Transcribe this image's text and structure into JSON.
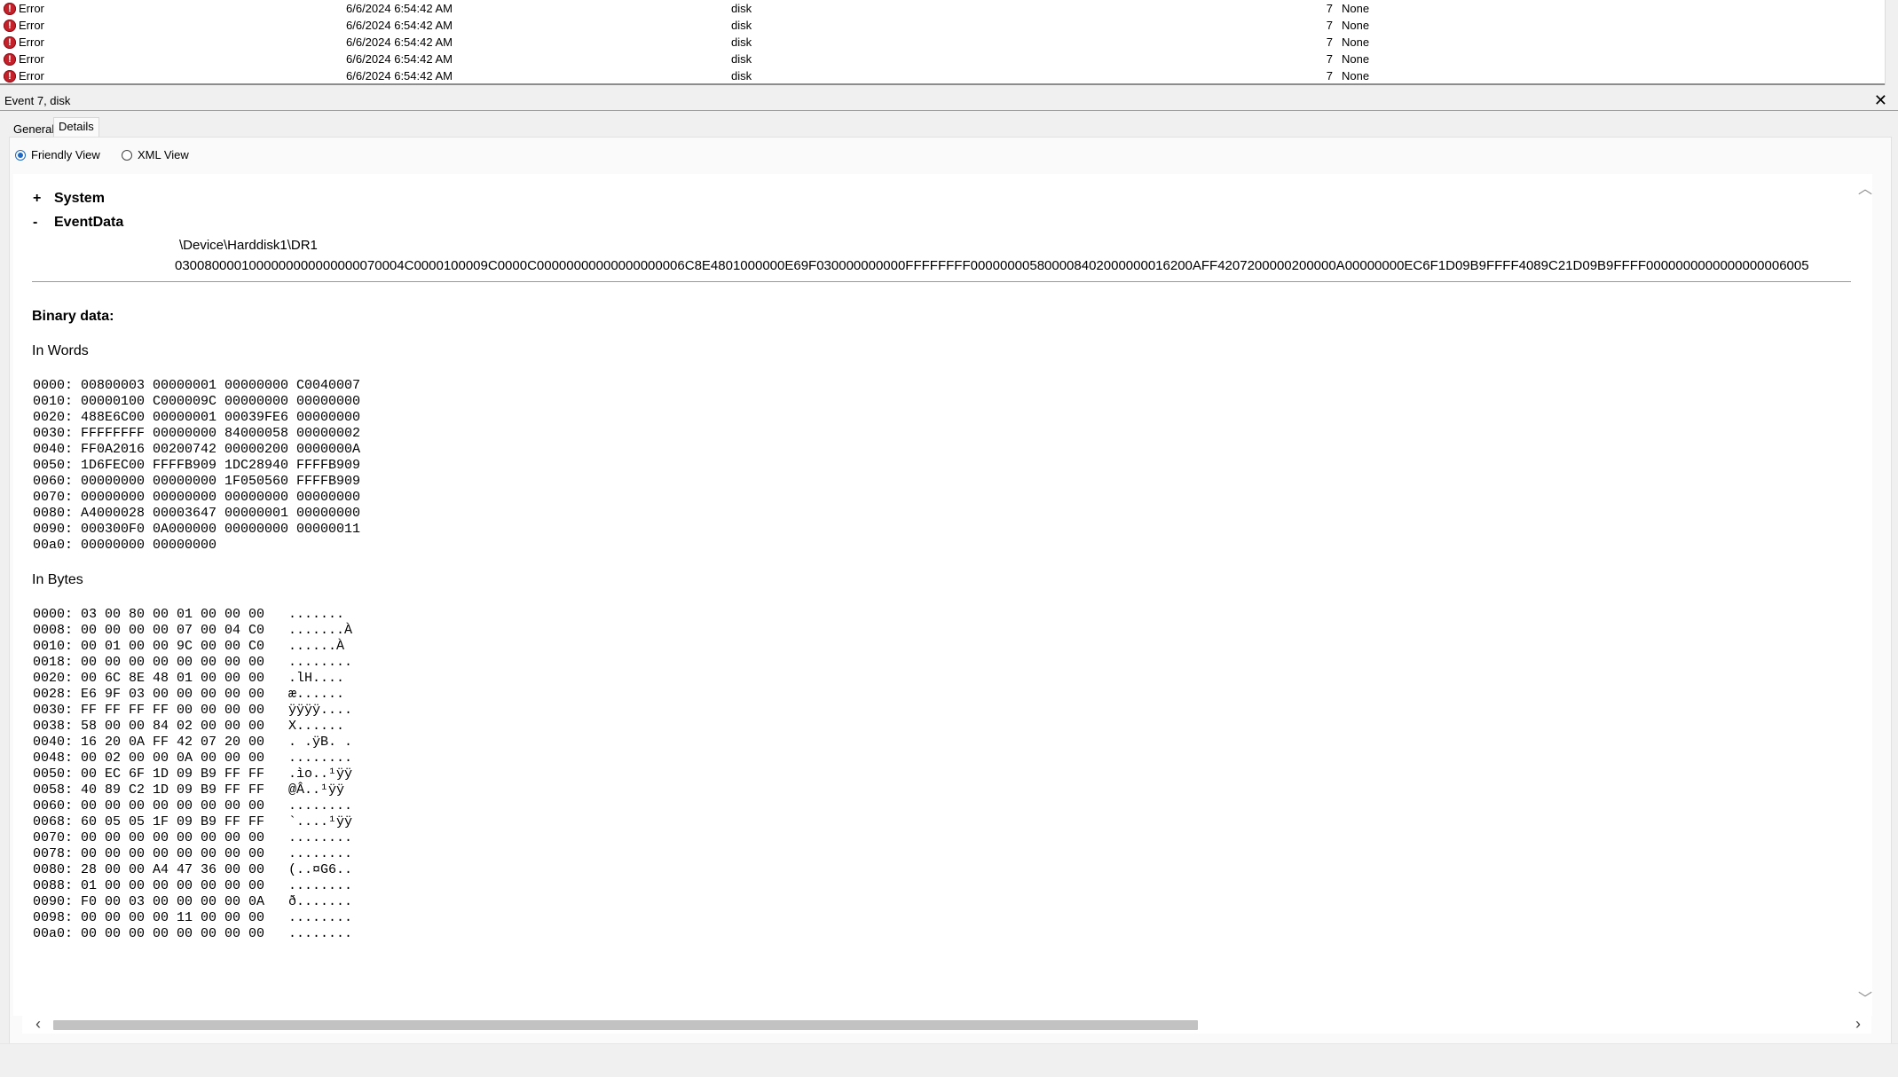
{
  "event_list": {
    "rows": [
      {
        "level": "Error",
        "date": "6/6/2024 6:54:42 AM",
        "source": "disk",
        "event_id": "7",
        "task": "None"
      },
      {
        "level": "Error",
        "date": "6/6/2024 6:54:42 AM",
        "source": "disk",
        "event_id": "7",
        "task": "None"
      },
      {
        "level": "Error",
        "date": "6/6/2024 6:54:42 AM",
        "source": "disk",
        "event_id": "7",
        "task": "None"
      },
      {
        "level": "Error",
        "date": "6/6/2024 6:54:42 AM",
        "source": "disk",
        "event_id": "7",
        "task": "None"
      },
      {
        "level": "Error",
        "date": "6/6/2024 6:54:42 AM",
        "source": "disk",
        "event_id": "7",
        "task": "None"
      }
    ]
  },
  "details": {
    "title": "Event 7, disk",
    "close_glyph": "✕",
    "tabs": [
      "General",
      "Details"
    ],
    "active_tab": "Details",
    "view_options": {
      "friendly": "Friendly View",
      "xml": "XML View",
      "selected": "friendly"
    },
    "tree": {
      "system": {
        "toggle": "+",
        "label": "System"
      },
      "eventdata": {
        "toggle": "-",
        "label": "EventData"
      }
    },
    "event_data": {
      "device": "\\Device\\Harddisk1\\DR1",
      "hex": "0300800001000000000000000070004C0000100009C0000C00000000000000000006C8E4801000000E69F030000000000FFFFFFFF000000005800008402000000016200AFF4207200000200000A00000000EC6F1D09B9FFFF4089C21D09B9FFFF0000000000000000006005"
    },
    "binary": {
      "title": "Binary data:",
      "words_title": "In Words",
      "bytes_title": "In Bytes",
      "words": [
        "0000: 00800003 00000001 00000000 C0040007",
        "0010: 00000100 C000009C 00000000 00000000",
        "0020: 488E6C00 00000001 00039FE6 00000000",
        "0030: FFFFFFFF 00000000 84000058 00000002",
        "0040: FF0A2016 00200742 00000200 0000000A",
        "0050: 1D6FEC00 FFFFB909 1DC28940 FFFFB909",
        "0060: 00000000 00000000 1F050560 FFFFB909",
        "0070: 00000000 00000000 00000000 00000000",
        "0080: A4000028 00003647 00000001 00000000",
        "0090: 000300F0 0A000000 00000000 00000011",
        "00a0: 00000000 00000000"
      ],
      "bytes": [
        "0000: 03 00 80 00 01 00 00 00   .......",
        "0008: 00 00 00 00 07 00 04 C0   .......À",
        "0010: 00 01 00 00 9C 00 00 C0   ......À",
        "0018: 00 00 00 00 00 00 00 00   ........",
        "0020: 00 6C 8E 48 01 00 00 00   .lH....",
        "0028: E6 9F 03 00 00 00 00 00   æ......",
        "0030: FF FF FF FF 00 00 00 00   ÿÿÿÿ....",
        "0038: 58 00 00 84 02 00 00 00   X......",
        "0040: 16 20 0A FF 42 07 20 00   . .ÿB. .",
        "0048: 00 02 00 00 0A 00 00 00   ........",
        "0050: 00 EC 6F 1D 09 B9 FF FF   .ìo..¹ÿÿ",
        "0058: 40 89 C2 1D 09 B9 FF FF   @Â..¹ÿÿ",
        "0060: 00 00 00 00 00 00 00 00   ........",
        "0068: 60 05 05 1F 09 B9 FF FF   `....¹ÿÿ",
        "0070: 00 00 00 00 00 00 00 00   ........",
        "0078: 00 00 00 00 00 00 00 00   ........",
        "0080: 28 00 00 A4 47 36 00 00   (..¤G6..",
        "0088: 01 00 00 00 00 00 00 00   ........",
        "0090: F0 00 03 00 00 00 00 0A   ð.......",
        "0098: 00 00 00 00 11 00 00 00   ........",
        "00a0: 00 00 00 00 00 00 00 00   ........"
      ]
    },
    "scroll": {
      "up": "︿",
      "down": "﹀",
      "left": "‹",
      "right": "›"
    }
  },
  "colors": {
    "error_icon": "#c4212a",
    "radio_selected": "#1d68c2",
    "scroll_thumb": "#c2c2c2"
  },
  "icons": {
    "error": "error-icon",
    "close": "close-icon"
  }
}
